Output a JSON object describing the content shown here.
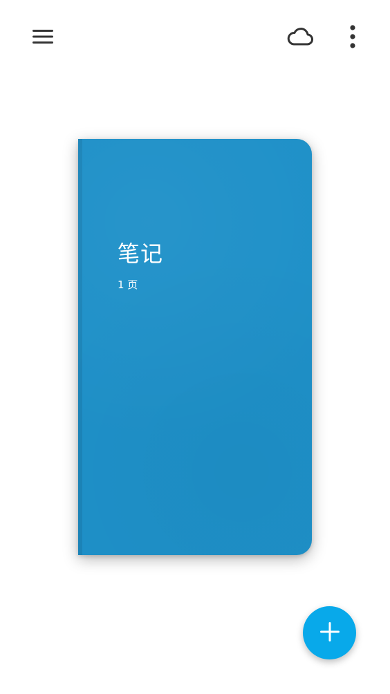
{
  "topbar": {
    "menu_icon": "hamburger-menu-icon",
    "sync_icon": "cloud-icon",
    "more_icon": "more-vertical-icon"
  },
  "notebooks": [
    {
      "title": "笔记",
      "pages": "1 页",
      "cover_color": "#1e90c8"
    }
  ],
  "fab": {
    "icon": "plus-icon",
    "color": "#08a9ea"
  }
}
